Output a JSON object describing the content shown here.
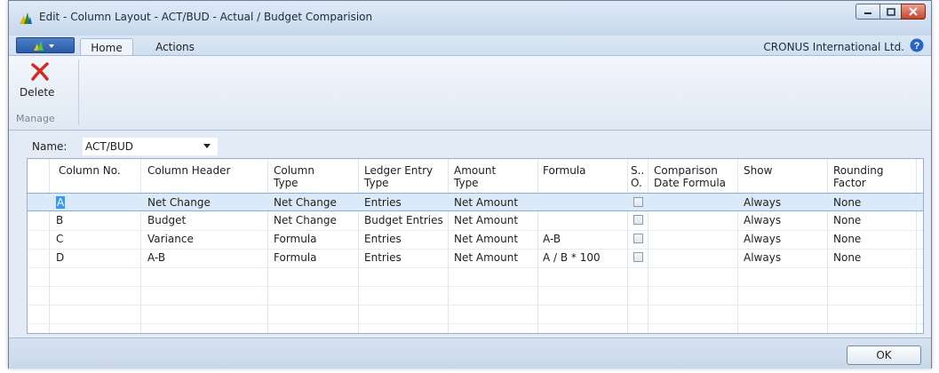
{
  "window": {
    "title": "Edit - Column Layout - ACT/BUD - Actual / Budget Comparision"
  },
  "ribbon": {
    "tabs": [
      {
        "label": "Home"
      },
      {
        "label": "Actions"
      }
    ],
    "company": "CRONUS International Ltd.",
    "delete_label": "Delete",
    "group_label": "Manage"
  },
  "name_field": {
    "label": "Name:",
    "value": "ACT/BUD"
  },
  "grid": {
    "columns": [
      {
        "line1": "Column No.",
        "line2": ""
      },
      {
        "line1": "Column Header",
        "line2": ""
      },
      {
        "line1": "Column",
        "line2": "Type"
      },
      {
        "line1": "Ledger Entry",
        "line2": "Type"
      },
      {
        "line1": "Amount",
        "line2": "Type"
      },
      {
        "line1": "Formula",
        "line2": ""
      },
      {
        "line1": "S..",
        "line2": "O."
      },
      {
        "line1": "Comparison",
        "line2": "Date Formula"
      },
      {
        "line1": "Show",
        "line2": ""
      },
      {
        "line1": "Rounding",
        "line2": "Factor"
      }
    ],
    "rows": [
      {
        "no": "A",
        "header": "Net Change",
        "type": "Net Change",
        "ledger": "Entries",
        "amount": "Net Amount",
        "formula": "",
        "cmp": "",
        "show": "Always",
        "round": "None"
      },
      {
        "no": "B",
        "header": "Budget",
        "type": "Net Change",
        "ledger": "Budget Entries",
        "amount": "Net Amount",
        "formula": "",
        "cmp": "",
        "show": "Always",
        "round": "None"
      },
      {
        "no": "C",
        "header": "Variance",
        "type": "Formula",
        "ledger": "Entries",
        "amount": "Net Amount",
        "formula": "A-B",
        "cmp": "",
        "show": "Always",
        "round": "None"
      },
      {
        "no": "D",
        "header": "A-B",
        "type": "Formula",
        "ledger": "Entries",
        "amount": "Net Amount",
        "formula": "A / B * 100",
        "cmp": "",
        "show": "Always",
        "round": "None"
      }
    ]
  },
  "footer": {
    "ok_label": "OK"
  }
}
